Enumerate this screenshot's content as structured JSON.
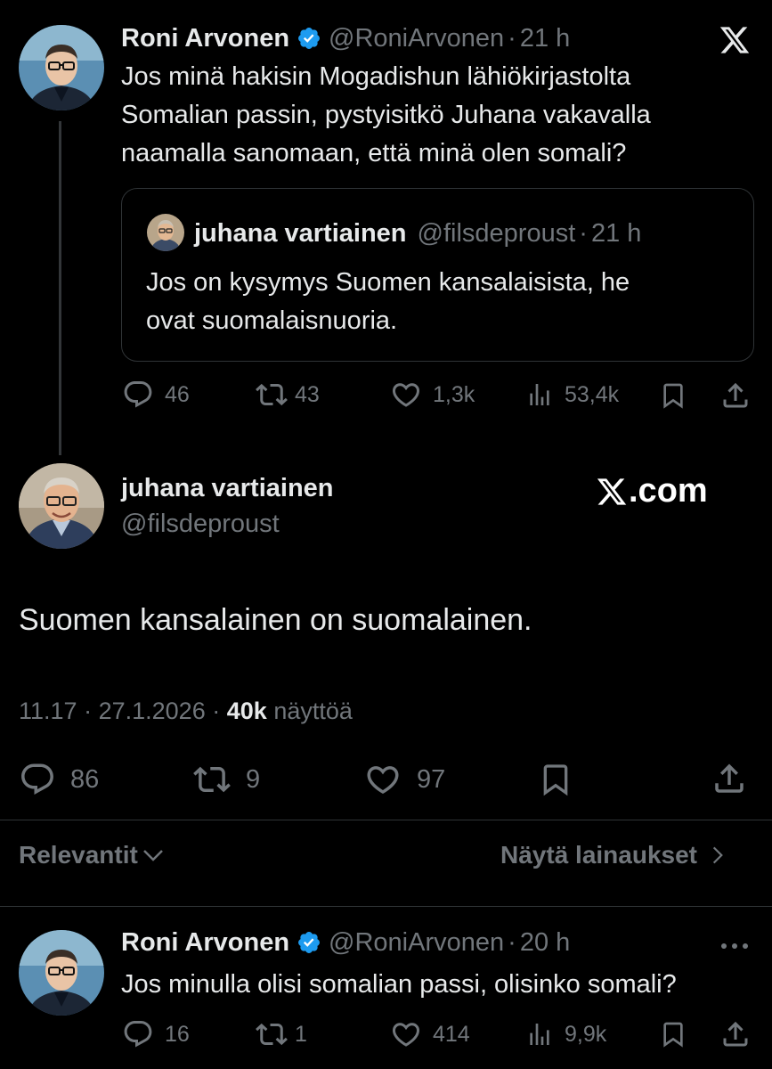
{
  "tweet1": {
    "display_name": "Roni Arvonen",
    "handle": "@RoniArvonen",
    "separator": "·",
    "time": "21 h",
    "lines": [
      "Jos minä hakisin Mogadishun lähiökirjastolta",
      "Somalian passin, pystyisitkö Juhana vakavalla",
      "naamalla sanomaan, että minä olen somali?"
    ],
    "quote": {
      "display_name": "juhana vartiainen",
      "handle": "@filsdeproust",
      "separator": "·",
      "time": "21 h",
      "lines": [
        "Jos on kysymys Suomen kansalaisista, he",
        "ovat suomalaisnuoria."
      ]
    },
    "replies": "46",
    "reposts": "43",
    "likes": "1,3k",
    "views": "53,4k"
  },
  "main_tweet": {
    "display_name": "juhana vartiainen",
    "handle": "@filsdeproust",
    "text": "Suomen kansalainen on suomalainen.",
    "time": "11.17",
    "date": "27.1.2026",
    "separator": "·",
    "views_count": "40k",
    "views_label": "näyttöä",
    "replies": "86",
    "reposts": "9",
    "likes": "97"
  },
  "watermark": {
    "text": ".com"
  },
  "sort": {
    "label": "Relevantit",
    "quotes_link": "Näytä lainaukset"
  },
  "reply": {
    "display_name": "Roni Arvonen",
    "handle": "@RoniArvonen",
    "separator": "·",
    "time": "20 h",
    "text": "Jos minulla olisi somalian passi, olisinko somali?",
    "replies": "16",
    "reposts": "1",
    "likes": "414",
    "views": "9,9k"
  },
  "colors": {
    "background": "#000000",
    "text": "#e7e9ea",
    "muted": "#71767b",
    "verified": "#1d9bf0",
    "border": "#2f3336"
  }
}
